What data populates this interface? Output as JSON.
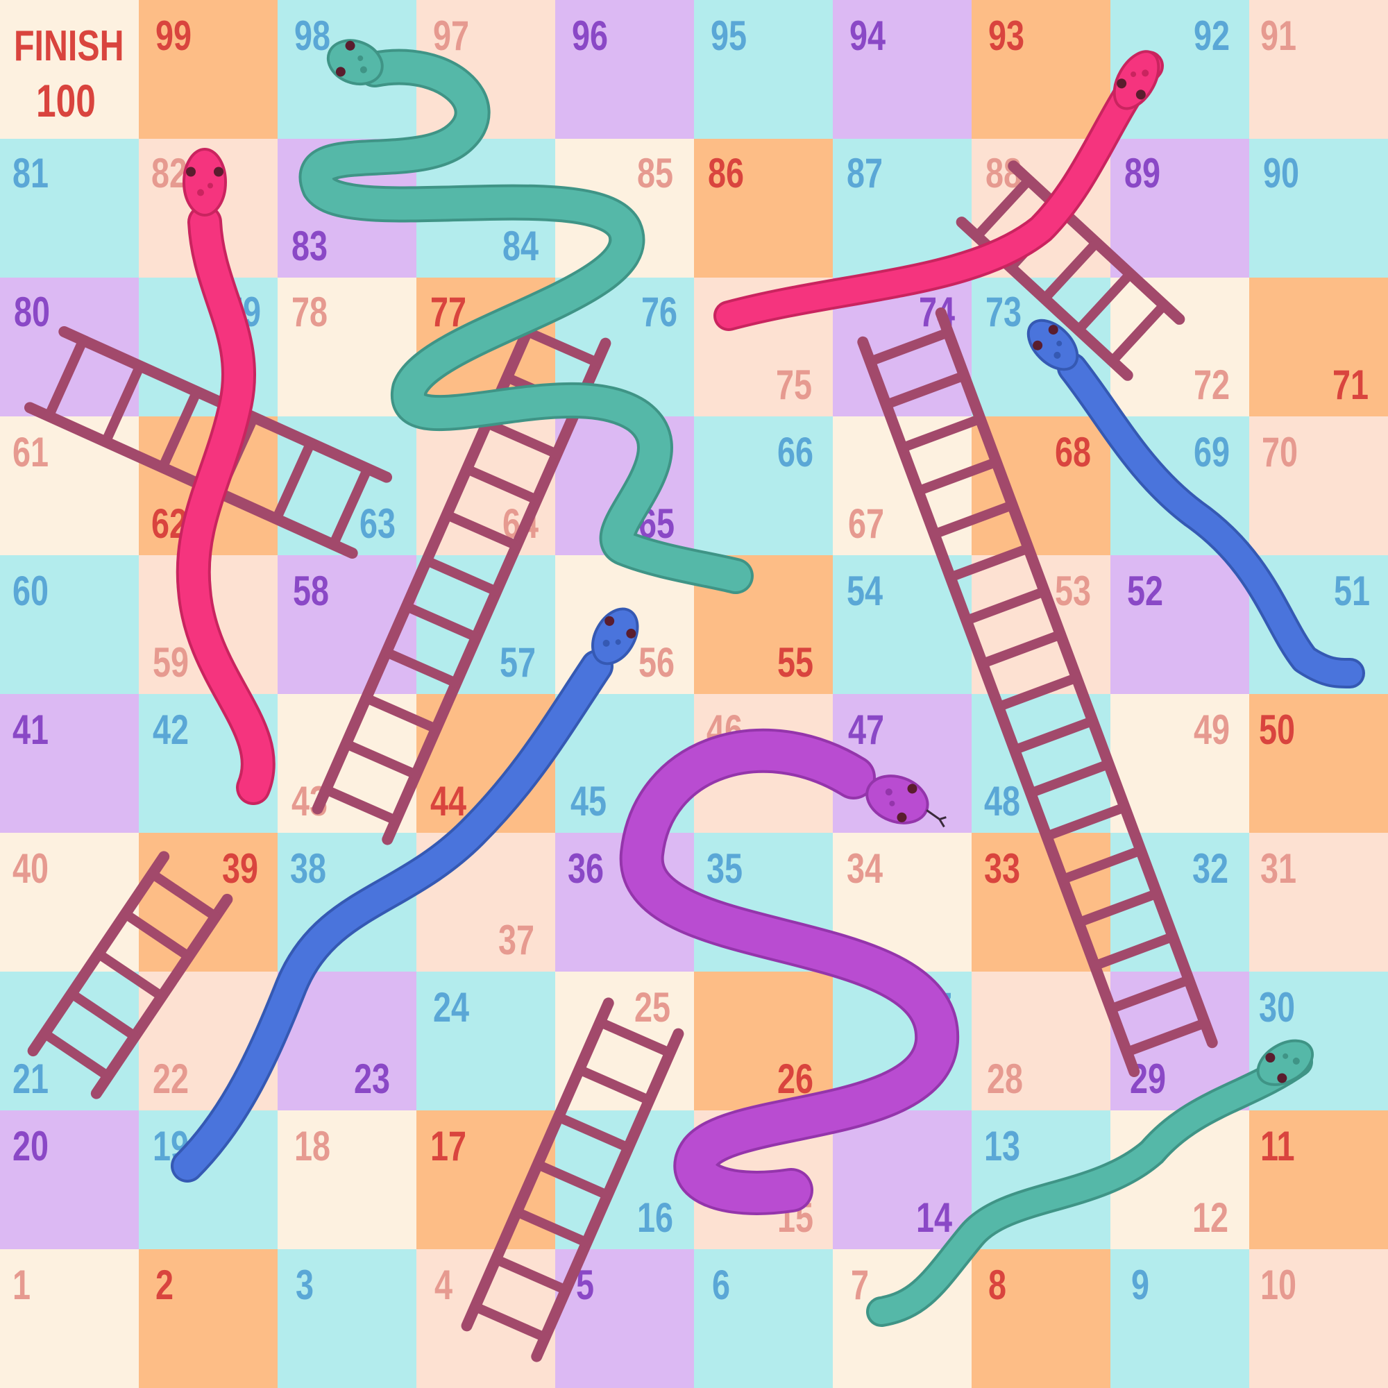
{
  "board": {
    "finish_label": "FINISH",
    "finish_number": "100",
    "palette": {
      "cream": "#fdf1e0",
      "peach": "#fde1d2",
      "orange": "#fdbd86",
      "cyan": "#b3eced",
      "lavender": "#dcb9f3"
    },
    "number_colors": {
      "red": "#d9443e",
      "pink": "#e69a90",
      "blue": "#5aa7d6",
      "purple": "#8a48c6"
    },
    "ladder_color": "#a2496b",
    "rows": [
      [
        {
          "n": "100",
          "bg": "cream",
          "c": "red"
        },
        {
          "n": "99",
          "bg": "orange",
          "c": "red"
        },
        {
          "n": "98",
          "bg": "cyan",
          "c": "blue"
        },
        {
          "n": "97",
          "bg": "peach",
          "c": "pink"
        },
        {
          "n": "96",
          "bg": "lavender",
          "c": "purple"
        },
        {
          "n": "95",
          "bg": "cyan",
          "c": "blue"
        },
        {
          "n": "94",
          "bg": "lavender",
          "c": "purple"
        },
        {
          "n": "93",
          "bg": "orange",
          "c": "red"
        },
        {
          "n": "92",
          "bg": "cyan",
          "c": "blue"
        },
        {
          "n": "91",
          "bg": "peach",
          "c": "pink"
        }
      ],
      [
        {
          "n": "81",
          "bg": "cyan",
          "c": "blue"
        },
        {
          "n": "82",
          "bg": "peach",
          "c": "pink"
        },
        {
          "n": "83",
          "bg": "lavender",
          "c": "purple"
        },
        {
          "n": "84",
          "bg": "cyan",
          "c": "blue"
        },
        {
          "n": "85",
          "bg": "cream",
          "c": "pink"
        },
        {
          "n": "86",
          "bg": "orange",
          "c": "red"
        },
        {
          "n": "87",
          "bg": "cyan",
          "c": "blue"
        },
        {
          "n": "88",
          "bg": "peach",
          "c": "pink"
        },
        {
          "n": "89",
          "bg": "lavender",
          "c": "purple"
        },
        {
          "n": "90",
          "bg": "cyan",
          "c": "blue"
        }
      ],
      [
        {
          "n": "80",
          "bg": "lavender",
          "c": "purple"
        },
        {
          "n": "79",
          "bg": "cyan",
          "c": "blue"
        },
        {
          "n": "78",
          "bg": "cream",
          "c": "pink"
        },
        {
          "n": "77",
          "bg": "orange",
          "c": "red"
        },
        {
          "n": "76",
          "bg": "cyan",
          "c": "blue"
        },
        {
          "n": "75",
          "bg": "peach",
          "c": "pink"
        },
        {
          "n": "74",
          "bg": "lavender",
          "c": "purple"
        },
        {
          "n": "73",
          "bg": "cyan",
          "c": "blue"
        },
        {
          "n": "72",
          "bg": "cream",
          "c": "pink"
        },
        {
          "n": "71",
          "bg": "orange",
          "c": "red"
        }
      ],
      [
        {
          "n": "61",
          "bg": "cream",
          "c": "pink"
        },
        {
          "n": "62",
          "bg": "orange",
          "c": "red"
        },
        {
          "n": "63",
          "bg": "cyan",
          "c": "blue"
        },
        {
          "n": "64",
          "bg": "peach",
          "c": "pink"
        },
        {
          "n": "65",
          "bg": "lavender",
          "c": "purple"
        },
        {
          "n": "66",
          "bg": "cyan",
          "c": "blue"
        },
        {
          "n": "67",
          "bg": "cream",
          "c": "pink"
        },
        {
          "n": "68",
          "bg": "orange",
          "c": "red"
        },
        {
          "n": "69",
          "bg": "cyan",
          "c": "blue"
        },
        {
          "n": "70",
          "bg": "peach",
          "c": "pink"
        }
      ],
      [
        {
          "n": "60",
          "bg": "cyan",
          "c": "blue"
        },
        {
          "n": "59",
          "bg": "peach",
          "c": "pink"
        },
        {
          "n": "58",
          "bg": "lavender",
          "c": "purple"
        },
        {
          "n": "57",
          "bg": "cyan",
          "c": "blue"
        },
        {
          "n": "56",
          "bg": "cream",
          "c": "pink"
        },
        {
          "n": "55",
          "bg": "orange",
          "c": "red"
        },
        {
          "n": "54",
          "bg": "cyan",
          "c": "blue"
        },
        {
          "n": "53",
          "bg": "peach",
          "c": "pink"
        },
        {
          "n": "52",
          "bg": "lavender",
          "c": "purple"
        },
        {
          "n": "51",
          "bg": "cyan",
          "c": "blue"
        }
      ],
      [
        {
          "n": "41",
          "bg": "lavender",
          "c": "purple"
        },
        {
          "n": "42",
          "bg": "cyan",
          "c": "blue"
        },
        {
          "n": "43",
          "bg": "cream",
          "c": "pink"
        },
        {
          "n": "44",
          "bg": "orange",
          "c": "red"
        },
        {
          "n": "45",
          "bg": "cyan",
          "c": "blue"
        },
        {
          "n": "46",
          "bg": "peach",
          "c": "pink"
        },
        {
          "n": "47",
          "bg": "lavender",
          "c": "purple"
        },
        {
          "n": "48",
          "bg": "cyan",
          "c": "blue"
        },
        {
          "n": "49",
          "bg": "cream",
          "c": "pink"
        },
        {
          "n": "50",
          "bg": "orange",
          "c": "red"
        }
      ],
      [
        {
          "n": "40",
          "bg": "cream",
          "c": "pink"
        },
        {
          "n": "39",
          "bg": "orange",
          "c": "red"
        },
        {
          "n": "38",
          "bg": "cyan",
          "c": "blue"
        },
        {
          "n": "37",
          "bg": "peach",
          "c": "pink"
        },
        {
          "n": "36",
          "bg": "lavender",
          "c": "purple"
        },
        {
          "n": "35",
          "bg": "cyan",
          "c": "blue"
        },
        {
          "n": "34",
          "bg": "cream",
          "c": "pink"
        },
        {
          "n": "33",
          "bg": "orange",
          "c": "red"
        },
        {
          "n": "32",
          "bg": "cyan",
          "c": "blue"
        },
        {
          "n": "31",
          "bg": "peach",
          "c": "pink"
        }
      ],
      [
        {
          "n": "21",
          "bg": "cyan",
          "c": "blue"
        },
        {
          "n": "22",
          "bg": "peach",
          "c": "pink"
        },
        {
          "n": "23",
          "bg": "lavender",
          "c": "purple"
        },
        {
          "n": "24",
          "bg": "cyan",
          "c": "blue"
        },
        {
          "n": "25",
          "bg": "cream",
          "c": "pink"
        },
        {
          "n": "26",
          "bg": "orange",
          "c": "red"
        },
        {
          "n": "27",
          "bg": "cyan",
          "c": "blue"
        },
        {
          "n": "28",
          "bg": "peach",
          "c": "pink"
        },
        {
          "n": "29",
          "bg": "lavender",
          "c": "purple"
        },
        {
          "n": "30",
          "bg": "cyan",
          "c": "blue"
        }
      ],
      [
        {
          "n": "20",
          "bg": "lavender",
          "c": "purple"
        },
        {
          "n": "19",
          "bg": "cyan",
          "c": "blue"
        },
        {
          "n": "18",
          "bg": "cream",
          "c": "pink"
        },
        {
          "n": "17",
          "bg": "orange",
          "c": "red"
        },
        {
          "n": "16",
          "bg": "cyan",
          "c": "blue"
        },
        {
          "n": "15",
          "bg": "peach",
          "c": "pink"
        },
        {
          "n": "14",
          "bg": "lavender",
          "c": "purple"
        },
        {
          "n": "13",
          "bg": "cyan",
          "c": "blue"
        },
        {
          "n": "12",
          "bg": "cream",
          "c": "pink"
        },
        {
          "n": "11",
          "bg": "orange",
          "c": "red"
        }
      ],
      [
        {
          "n": "1",
          "bg": "cream",
          "c": "pink"
        },
        {
          "n": "2",
          "bg": "orange",
          "c": "red"
        },
        {
          "n": "3",
          "bg": "cyan",
          "c": "blue"
        },
        {
          "n": "4",
          "bg": "peach",
          "c": "pink"
        },
        {
          "n": "5",
          "bg": "lavender",
          "c": "purple"
        },
        {
          "n": "6",
          "bg": "cyan",
          "c": "blue"
        },
        {
          "n": "7",
          "bg": "cream",
          "c": "pink"
        },
        {
          "n": "8",
          "bg": "orange",
          "c": "red"
        },
        {
          "n": "9",
          "bg": "cyan",
          "c": "blue"
        },
        {
          "n": "10",
          "bg": "peach",
          "c": "pink"
        }
      ]
    ]
  },
  "snakes": [
    {
      "name": "green-snake-top",
      "color": "#55b8a8",
      "shade": "#3f9486"
    },
    {
      "name": "pink-snake-top-right",
      "color": "#f5347e",
      "shade": "#c9245f"
    },
    {
      "name": "pink-snake-left",
      "color": "#f5347e",
      "shade": "#c9245f"
    },
    {
      "name": "blue-snake-right",
      "color": "#4a74dc",
      "shade": "#3559b3"
    },
    {
      "name": "blue-snake-center",
      "color": "#4a74dc",
      "shade": "#3559b3"
    },
    {
      "name": "purple-snake",
      "color": "#b94cd1",
      "shade": "#9435ab"
    },
    {
      "name": "green-snake-bottom",
      "color": "#55b8a8",
      "shade": "#3f9486"
    }
  ],
  "ladders": [
    {
      "name": "ladder-top-left"
    },
    {
      "name": "ladder-top-right"
    },
    {
      "name": "ladder-center"
    },
    {
      "name": "ladder-long-right"
    },
    {
      "name": "ladder-left-short"
    },
    {
      "name": "ladder-bottom-center"
    }
  ]
}
